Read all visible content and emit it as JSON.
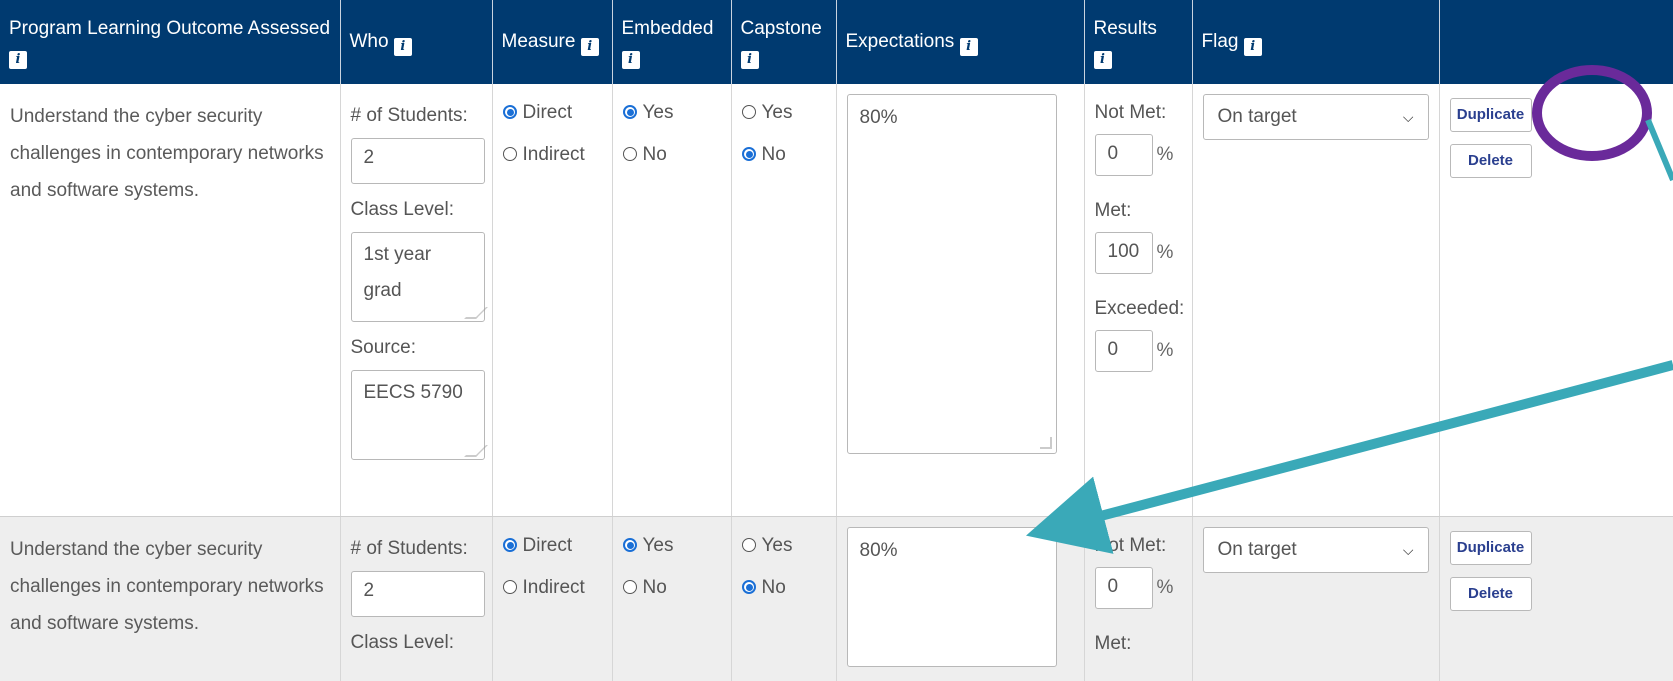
{
  "headers": {
    "outcome": "Program Learning Outcome Assessed",
    "who": "Who",
    "measure": "Measure",
    "embedded": "Embedded",
    "capstone": "Capstone",
    "expectations": "Expectations",
    "results": "Results",
    "flag": "Flag",
    "info_glyph": "i"
  },
  "labels": {
    "num_students": "# of Students:",
    "class_level": "Class Level:",
    "source": "Source:",
    "direct": "Direct",
    "indirect": "Indirect",
    "yes": "Yes",
    "no": "No",
    "not_met": "Not Met:",
    "met": "Met:",
    "exceeded": "Exceeded:",
    "percent": "%",
    "duplicate": "Duplicate",
    "delete": "Delete"
  },
  "rows": [
    {
      "outcome": "Understand the cyber security challenges in contemporary networks and software systems.",
      "num_students": "2",
      "class_level_line1": "1st year",
      "class_level_line2": "grad",
      "source": "EECS 5790",
      "measure": "Direct",
      "embedded": "Yes",
      "capstone": "No",
      "expectations": "80%",
      "not_met": "0",
      "met": "100",
      "exceeded": "0",
      "flag": "On target"
    },
    {
      "outcome": "Understand the cyber security challenges in contemporary networks and software systems.",
      "num_students": "2",
      "measure": "Direct",
      "embedded": "Yes",
      "capstone": "No",
      "expectations": "80%",
      "not_met": "0",
      "flag": "On target"
    }
  ],
  "colors": {
    "header_bg": "#003a70",
    "highlight_circle": "#6a2a9a",
    "annotation_arrow": "#3aa9b8",
    "radio_selected": "#1a6fd6"
  }
}
